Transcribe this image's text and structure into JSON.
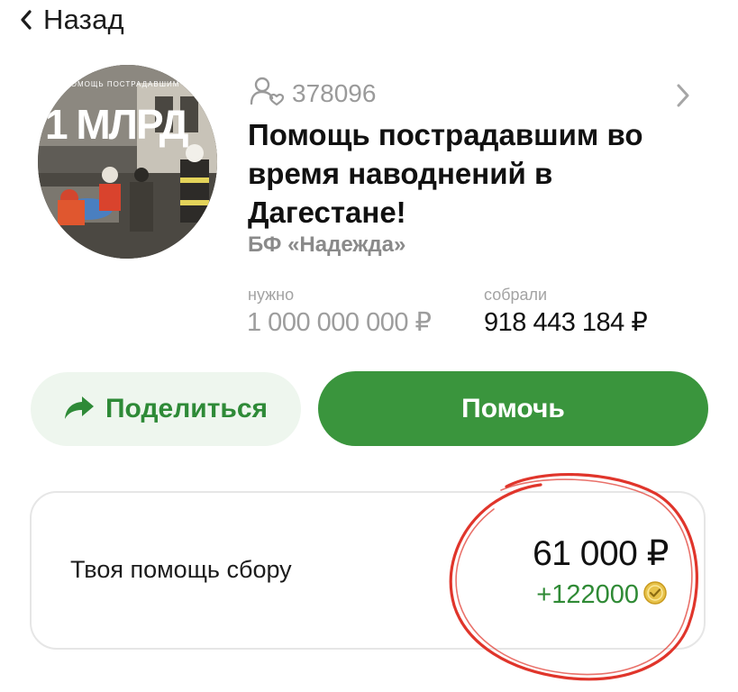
{
  "nav": {
    "back_label": "Назад"
  },
  "campaign": {
    "supporters_count": "378096",
    "title": "Помощь пострадавшим во время наводнений в Дагестане!",
    "organization": "БФ «Надежда»",
    "cover_banner_text": "ПОМОЩЬ ПОСТРАДАВШИМ",
    "cover_headline": "1 МЛРД"
  },
  "stats": {
    "need_label": "нужно",
    "need_value": "1 000 000 000 ₽",
    "collected_label": "собрали",
    "collected_value": "918 443 184 ₽"
  },
  "actions": {
    "share_label": "Поделиться",
    "help_label": "Помочь"
  },
  "contribution": {
    "label": "Твоя помощь сбору",
    "amount": "61 000 ₽",
    "bonus": "+122000"
  },
  "colors": {
    "accent_green": "#3a953d",
    "share_bg": "#eef6ee",
    "annotation_red": "#e0352b"
  },
  "icons": {
    "back": "chevron-left-icon",
    "supporters": "people-heart-icon",
    "details": "chevron-right-icon",
    "share": "share-arrow-icon",
    "bonus": "bonus-coin-icon"
  }
}
